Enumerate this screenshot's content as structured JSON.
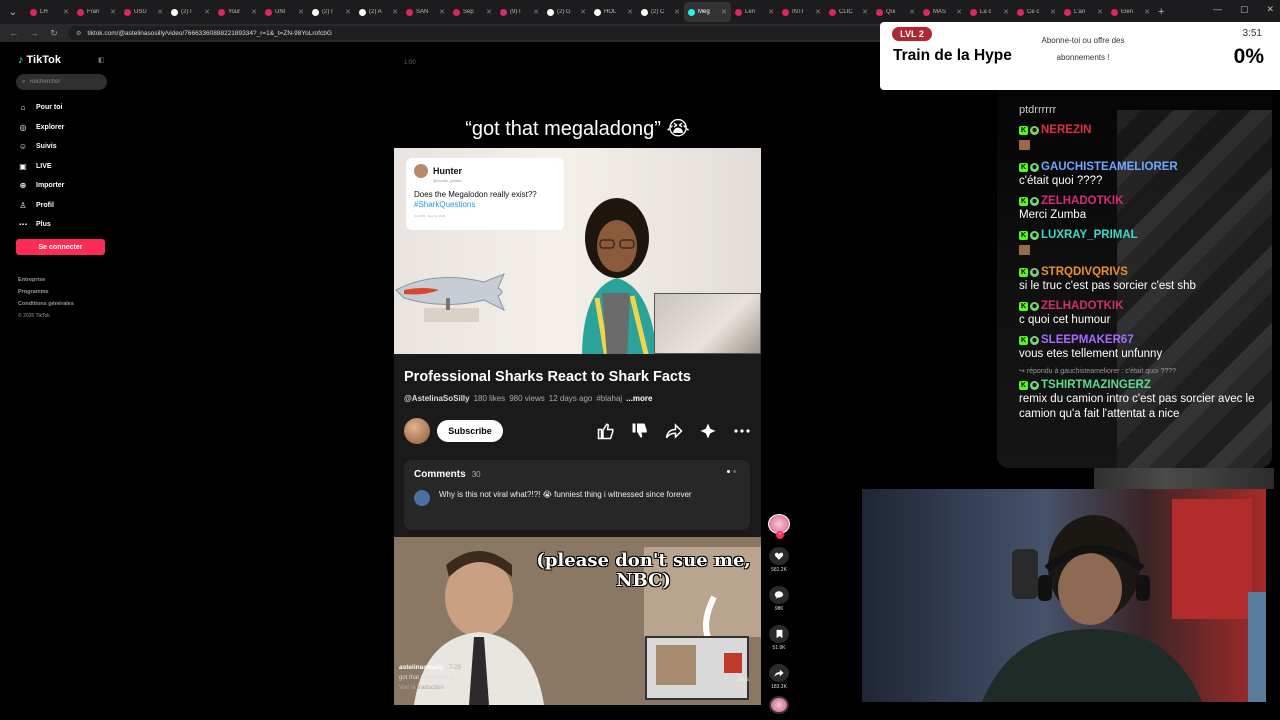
{
  "browser": {
    "tabs": [
      {
        "title": "LH",
        "color": "#e0245e"
      },
      {
        "title": "Fran",
        "color": "#e0245e"
      },
      {
        "title": "USU",
        "color": "#e0245e"
      },
      {
        "title": "(2) I",
        "color": "#ffffff"
      },
      {
        "title": "Your",
        "color": "#e0245e"
      },
      {
        "title": "UNI",
        "color": "#e0245e"
      },
      {
        "title": "(2) I",
        "color": "#ffffff"
      },
      {
        "title": "(2) A",
        "color": "#ffffff"
      },
      {
        "title": "SAN",
        "color": "#e0245e"
      },
      {
        "title": "Sep",
        "color": "#e0245e"
      },
      {
        "title": "(9) I",
        "color": "#d62976"
      },
      {
        "title": "(2) G",
        "color": "#ffffff"
      },
      {
        "title": "HOL",
        "color": "#ffffff"
      },
      {
        "title": "(2) C",
        "color": "#ffffff"
      },
      {
        "title": "Meg",
        "color": "#25f4ee"
      },
      {
        "title": "Len",
        "color": "#e0245e"
      },
      {
        "title": "INTI",
        "color": "#e0245e"
      },
      {
        "title": "CLIC",
        "color": "#e0245e"
      },
      {
        "title": "Qui",
        "color": "#e0245e"
      },
      {
        "title": "MAS",
        "color": "#e0245e"
      },
      {
        "title": "La c",
        "color": "#e0245e"
      },
      {
        "title": "Ce c",
        "color": "#e0245e"
      },
      {
        "title": "L'an",
        "color": "#e0245e"
      },
      {
        "title": "Elen",
        "color": "#e0245e"
      }
    ],
    "url": "tiktok.com/@astelinasosilly/video/7666336088822189334?_r=1&_t=ZN-98YoLrofcbG"
  },
  "tiktok": {
    "logo": "TikTok",
    "search_placeholder": "Rechercher",
    "nav": [
      {
        "label": "Pour toi",
        "icon": "home-icon"
      },
      {
        "label": "Explorer",
        "icon": "compass-icon"
      },
      {
        "label": "Suivis",
        "icon": "following-icon"
      },
      {
        "label": "LIVE",
        "icon": "live-icon"
      },
      {
        "label": "Importer",
        "icon": "upload-icon"
      },
      {
        "label": "Profil",
        "icon": "profile-icon"
      },
      {
        "label": "Plus",
        "icon": "more-icon"
      }
    ],
    "login": "Se connecter",
    "footer": [
      "Entreprise",
      "Programme",
      "Conditions générales"
    ],
    "copyright": "© 2026 TikTok"
  },
  "video": {
    "timecode": "1:00",
    "title": "“got that megaladong” 😭",
    "tweet": {
      "name": "Hunter",
      "handle": "@hunter_jordan",
      "text": "Does the Megalodon really exist??",
      "tag": "#SharkQuestions",
      "date": "3:12 PM · Aug 11, 2022"
    },
    "yt_title": "Professional Sharks React to Shark Facts",
    "channel": "@AstelinaSoSilly",
    "likes": "180 likes",
    "views": "980 views",
    "age": "12 days ago",
    "hashtag": "#blahaj",
    "more": "...more",
    "subscribe": "Subscribe",
    "comments_label": "Comments",
    "comments_count": "30",
    "top_comment": "Why is this not viral what?!?! 😭 funniest thing i witnessed since forever",
    "clip_caption": "(please don't sue me, NBC)",
    "overlay_user": "astelinasosilly",
    "overlay_date": "· 7-25",
    "overlay_desc": "got that megaladong",
    "overlay_translate": "Voir la traduction",
    "overlay_more": "plus"
  },
  "rail": {
    "likes": "581.2K",
    "comments": "986",
    "saves": "51.9K",
    "shares": "183.3K"
  },
  "hype": {
    "level": "LVL 2",
    "title": "Train de la Hype",
    "subtitle": "Abonne-toi ou offre des abonnements !",
    "time": "3:51",
    "percent": "0%"
  },
  "chat": {
    "previous": "ptdrrrrrr",
    "messages": [
      {
        "user": "NEREZIN",
        "color": "#e0303a",
        "text": "",
        "small_badge": true
      },
      {
        "user": "GAUCHISTEAMELIORER",
        "color": "#6fa8ff",
        "text": "c'était quoi ????"
      },
      {
        "user": "ZELHADOTKIK",
        "color": "#d42d6f",
        "text": "Merci Zumba"
      },
      {
        "user": "LUXRAY_PRIMAL",
        "color": "#3fd9c4",
        "text": "",
        "small_badge": true
      },
      {
        "user": "STRQDIVQRIVS",
        "color": "#e8912d",
        "text": "si le truc c'est pas sorcier c'est shb"
      },
      {
        "user": "ZELHADOTKIK",
        "color": "#d42d6f",
        "text": "c quoi cet humour"
      },
      {
        "user": "SLEEPMAKER67",
        "color": "#a66bff",
        "text": "vous etes tellement unfunny"
      },
      {
        "user": "TSHIRTMAZINGERZ",
        "color": "#5ddc8a",
        "reply": "↪ répondu à gauchisteameliorer : c'était quoi ????",
        "text": "remix du camion intro c'est pas sorcier avec le camion qu'a fait l'attentat a nice"
      }
    ]
  }
}
